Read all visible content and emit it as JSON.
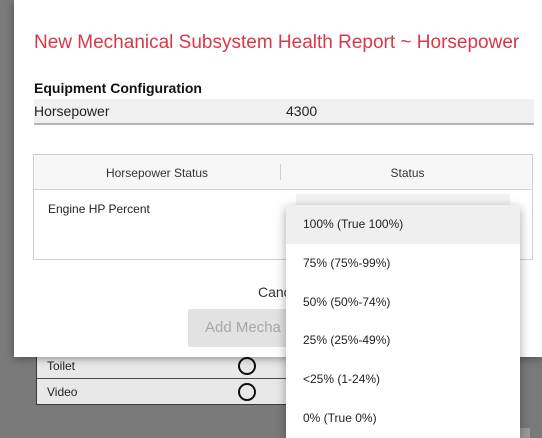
{
  "modal": {
    "title": "New Mechanical Subsystem Health Report ~ Horsepower"
  },
  "equipment": {
    "section_title": "Equipment Configuration",
    "label": "Horsepower",
    "value": "4300"
  },
  "status_table": {
    "columns": [
      "Horsepower Status",
      "Status"
    ],
    "rows": [
      {
        "label": "Engine HP Percent"
      }
    ]
  },
  "actions": {
    "cancel_label": "Canc",
    "add_label": "Add Mecha"
  },
  "dropdown": {
    "options": [
      "100% (True 100%)",
      "75% (75%-99%)",
      "50% (50%-74%)",
      "25% (25%-49%)",
      "<25% (1-24%)",
      "0% (True 0%)"
    ],
    "highlighted_index": 0
  },
  "background": {
    "rows": [
      {
        "label": "Toilet"
      },
      {
        "label": "Video"
      }
    ]
  }
}
